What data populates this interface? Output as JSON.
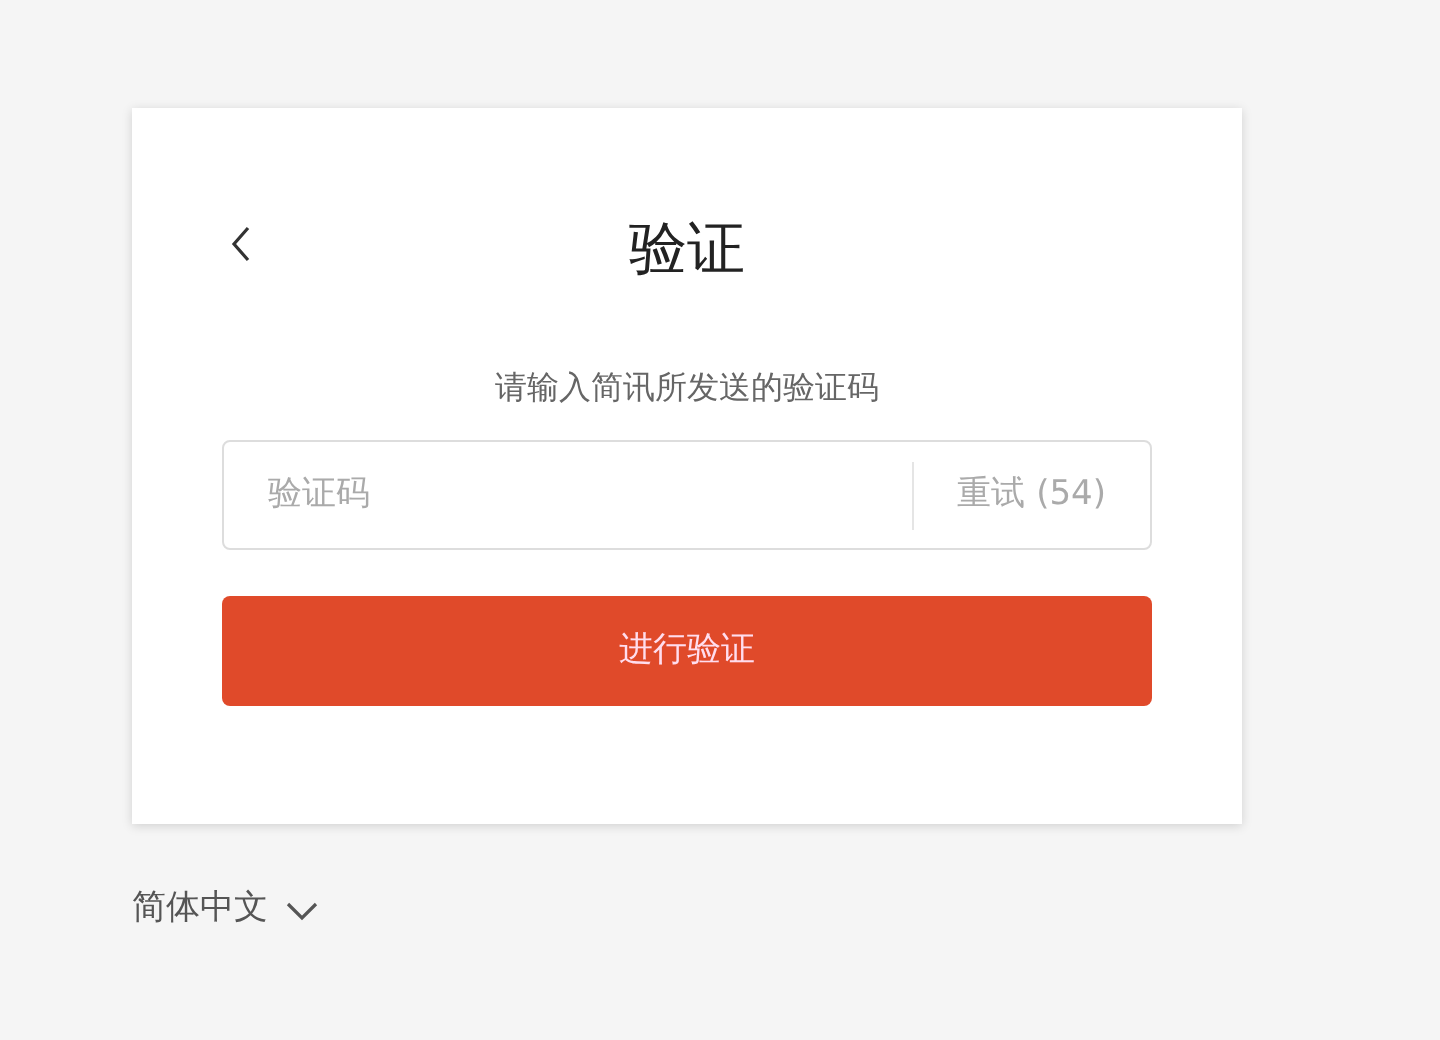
{
  "header": {
    "title": "验证"
  },
  "instruction": "请输入简讯所发送的验证码",
  "code_field": {
    "placeholder": "验证码"
  },
  "retry": {
    "label": "重试 (54)",
    "disabled": true
  },
  "submit": {
    "label": "进行验证"
  },
  "language": {
    "label": "简体中文"
  }
}
